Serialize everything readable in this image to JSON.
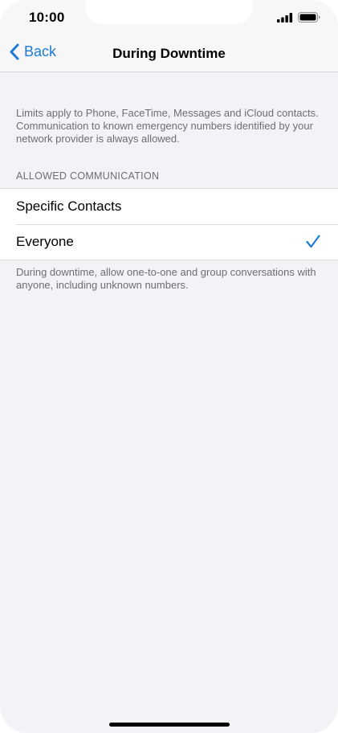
{
  "status_bar": {
    "time": "10:00",
    "icons": [
      "cellular-signal-icon",
      "battery-icon"
    ]
  },
  "nav": {
    "back_label": "Back",
    "title": "During Downtime"
  },
  "intro": {
    "text": "Limits apply to Phone, FaceTime, Messages and iCloud contacts. Communication to known emergency numbers identified by your network provider is always allowed."
  },
  "allowed_communication": {
    "header": "ALLOWED COMMUNICATION",
    "options": [
      {
        "label": "Specific Contacts",
        "selected": false
      },
      {
        "label": "Everyone",
        "selected": true
      }
    ],
    "footer": "During downtime, allow one-to-one and group conversations with anyone, including unknown numbers."
  },
  "colors": {
    "accent": "#1c7bd6",
    "background": "#f2f2f7",
    "secondary_text": "#6d6d72"
  }
}
